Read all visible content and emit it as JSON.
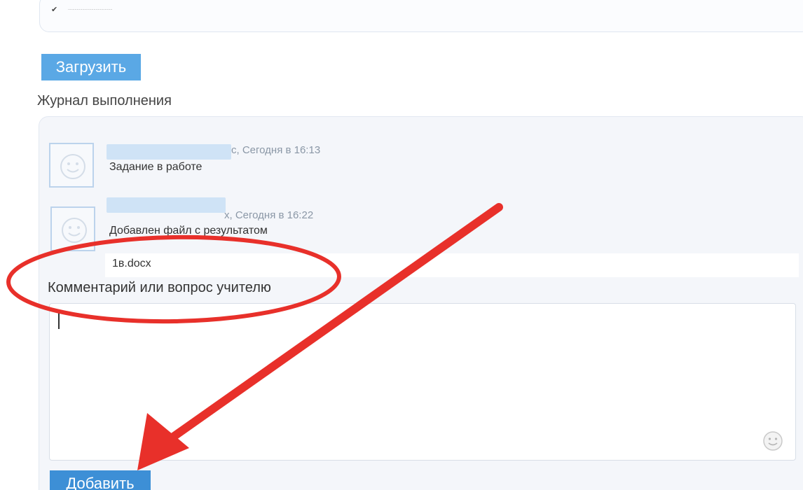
{
  "attachment_box": {
    "check_glyph": "✔",
    "caption": "........................................"
  },
  "upload": {
    "label": "Загрузить"
  },
  "journal": {
    "heading": "Журнал выполнения",
    "entries": [
      {
        "name_suffix": "с, Сегодня в 16:13",
        "text": "Задание в работе"
      },
      {
        "name_suffix": "х, Сегодня в 16:22",
        "text": "Добавлен файл с результатом",
        "file": "1в.docx"
      }
    ]
  },
  "comment": {
    "label": "Комментарий или вопрос учителю",
    "value": ""
  },
  "add": {
    "label": "Добавить"
  },
  "colors": {
    "accent_button": "#5aa8e5",
    "submit_button": "#3d8fd6",
    "annotation": "#e8302a"
  }
}
